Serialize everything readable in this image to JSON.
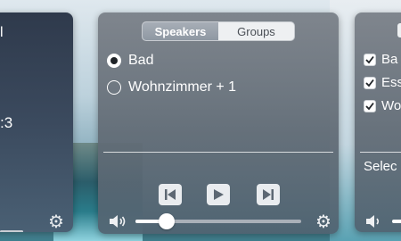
{
  "left_panel": {
    "top_text": "l",
    "mid_text": ":3"
  },
  "main_panel": {
    "tabs": [
      {
        "label": "Speakers",
        "active": true
      },
      {
        "label": "Groups",
        "active": false
      }
    ],
    "speakers": [
      {
        "label": "Bad",
        "selected": true
      },
      {
        "label": "Wohnzimmer + 1",
        "selected": false
      }
    ],
    "controls": {
      "previous": "previous-icon",
      "play": "play-icon",
      "next": "next-icon"
    },
    "volume": 0.19
  },
  "right_panel": {
    "items": [
      {
        "label": "Ba",
        "checked": true
      },
      {
        "label": "Ess",
        "checked": true
      },
      {
        "label": "Wo",
        "checked": true
      }
    ],
    "select_text": "Selec"
  },
  "colors": {
    "panel": "#6f7781",
    "control_bg": "#e9ecef",
    "icon_dark": "#5d6873"
  }
}
